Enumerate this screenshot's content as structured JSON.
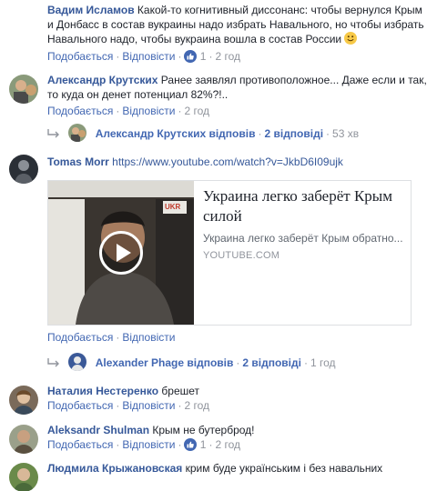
{
  "actions": {
    "like_label": "Подобається",
    "reply_label": "Відповісти",
    "separator": "·"
  },
  "comments": [
    {
      "author": "Вадим Исламов",
      "text": "Какой-то когнитивный диссонанс: чтобы вернулся Крым и Донбасс в состав вукраины надо избрать Навального, но чтобы избрать Навального надо, чтобы вукраина вошла в состав России",
      "likes": "1",
      "time": "2 год"
    },
    {
      "author": "Александр Крутских",
      "text": "Ранее заявлял противоположное... Даже если и так, то куда он денет потенциал 82%?!..",
      "time": "2 год",
      "reply_summary": {
        "name": "Александр Крутских відповів",
        "count": "2 відповіді",
        "time": "53 хв"
      }
    },
    {
      "author": "Tomas Morr",
      "link": "https://www.youtube.com/watch?v=JkbD6I09ujk",
      "preview": {
        "title": "Украина легко заберёт Крым силой",
        "description": "Украина легко заберёт Крым обратно...",
        "domain": "YOUTUBE.COM",
        "thumb_badge": "UKR"
      },
      "reply_summary": {
        "name": "Alexander Phage відповів",
        "count": "2 відповіді",
        "time": "1 год"
      }
    },
    {
      "author": "Наталия Нестеренко",
      "text": "брешет",
      "time": "2 год"
    },
    {
      "author": "Aleksandr Shulman",
      "text": "Крым не бутерброд!",
      "likes": "1",
      "time": "2 год"
    },
    {
      "author": "Людмила Крыжановская",
      "text": "крим буде українським і без навальних"
    }
  ]
}
